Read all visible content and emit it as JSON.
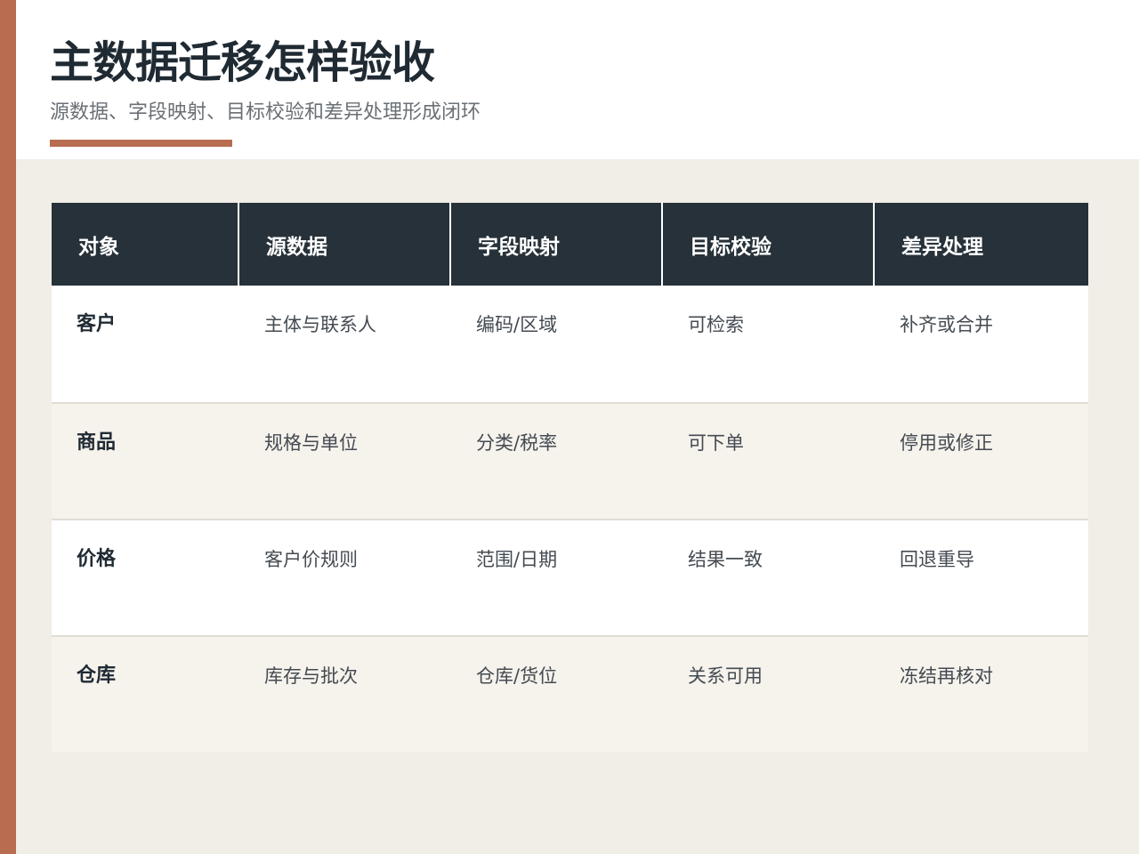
{
  "header": {
    "title": "主数据迁移怎样验收",
    "subtitle": "源数据、字段映射、目标校验和差异处理形成闭环"
  },
  "colors": {
    "accent": "#b86c50",
    "header_bg": "#263139",
    "background": "#f1ede7"
  },
  "table": {
    "columns": [
      "对象",
      "源数据",
      "字段映射",
      "目标校验",
      "差异处理"
    ],
    "rows": [
      [
        "客户",
        "主体与联系人",
        "编码/区域",
        "可检索",
        "补齐或合并"
      ],
      [
        "商品",
        "规格与单位",
        "分类/税率",
        "可下单",
        "停用或修正"
      ],
      [
        "价格",
        "客户价规则",
        "范围/日期",
        "结果一致",
        "回退重导"
      ],
      [
        "仓库",
        "库存与批次",
        "仓库/货位",
        "关系可用",
        "冻结再核对"
      ]
    ]
  }
}
